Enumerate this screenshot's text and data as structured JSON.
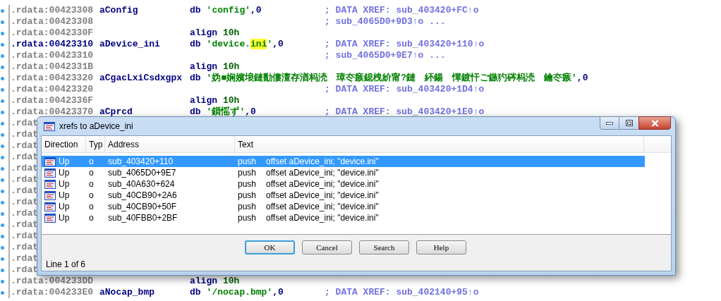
{
  "listing": {
    "rows": [
      {
        "address": ".rdata:00423308",
        "current": false,
        "label": "aConfig",
        "op": "db",
        "operand": [
          {
            "text": "'config'",
            "kind": "string"
          },
          {
            "text": ",0",
            "kind": "plain"
          }
        ],
        "comment": "; DATA XREF: sub_403420+FC↑o"
      },
      {
        "address": ".rdata:00423308",
        "current": false,
        "label": "",
        "op": "",
        "operand": [],
        "comment": "; sub_4065D0+9D3↑o ..."
      },
      {
        "address": ".rdata:0042330F",
        "current": false,
        "label": "",
        "op": "align",
        "operand": [
          {
            "text": "10h",
            "kind": "number"
          }
        ],
        "comment": ""
      },
      {
        "address": ".rdata:00423310",
        "current": true,
        "label": "aDevice_ini",
        "op": "db",
        "operand": [
          {
            "text": "'device.",
            "kind": "string"
          },
          {
            "text": "ini",
            "kind": "highlight"
          },
          {
            "text": "'",
            "kind": "string"
          },
          {
            "text": ",0",
            "kind": "plain"
          }
        ],
        "comment": "; DATA XREF: sub_403420+110↑o"
      },
      {
        "address": ".rdata:00423310",
        "current": false,
        "label": "",
        "op": "",
        "operand": [],
        "comment": "; sub_4065D0+9E7↑o ..."
      },
      {
        "address": ".rdata:0042331B",
        "current": false,
        "label": "",
        "op": "align",
        "operand": [
          {
            "text": "10h",
            "kind": "number"
          }
        ],
        "comment": ""
      },
      {
        "address": ".rdata:00423320",
        "current": false,
        "label": "aCgacLxiCsdxgpx",
        "op": "db",
        "operand": [
          {
            "text": "'妫■娴嬪埌鏈勫僂澶存湭杩涜　璋冭瘯鎴栧紒甯?鏈　紑鍚　憚鍍忓ご鏃犳硶杩涜　鑰冭瘯'",
            "kind": "string"
          },
          {
            "text": ",0",
            "kind": "plain"
          }
        ],
        "comment": ""
      },
      {
        "address": ".rdata:00423320",
        "current": false,
        "label": "",
        "op": "",
        "operand": [],
        "comment": "; DATA XREF: sub_403420+1D4↑o"
      },
      {
        "address": ".rdata:0042336F",
        "current": false,
        "label": "",
        "op": "align",
        "operand": [
          {
            "text": "10h",
            "kind": "number"
          }
        ],
        "comment": ""
      },
      {
        "address": ".rdata:00423370",
        "current": false,
        "label": "aCprcd",
        "op": "db",
        "operand": [
          {
            "text": "'鎻愮ず'",
            "kind": "string"
          },
          {
            "text": ",0",
            "kind": "plain"
          }
        ],
        "comment": "; DATA XREF: sub_403420+1E0↑o"
      },
      {
        "address": ".rdat",
        "current": false,
        "label": "",
        "op": "",
        "operand": [],
        "comment": ""
      },
      {
        "address": ".rdat",
        "current": false,
        "label": "",
        "op": "",
        "operand": [],
        "comment": ""
      },
      {
        "address": ".rdat",
        "current": false,
        "label": "",
        "op": "",
        "operand": [],
        "comment": ""
      },
      {
        "address": ".rdat",
        "current": false,
        "label": "",
        "op": "",
        "operand": [],
        "comment": ""
      },
      {
        "address": ".rdat",
        "current": false,
        "label": "",
        "op": "",
        "operand": [],
        "comment": ""
      },
      {
        "address": ".rdat",
        "current": false,
        "label": "",
        "op": "",
        "operand": [],
        "comment": ""
      },
      {
        "address": ".rdat",
        "current": false,
        "label": "",
        "op": "",
        "operand": [],
        "comment": ""
      },
      {
        "address": ".rdat",
        "current": false,
        "label": "",
        "op": "",
        "operand": [],
        "comment": ""
      },
      {
        "address": ".rdat",
        "current": false,
        "label": "",
        "op": "",
        "operand": [],
        "comment": ""
      },
      {
        "address": ".rdat",
        "current": false,
        "label": "",
        "op": "",
        "operand": [],
        "comment": ""
      },
      {
        "address": ".rdat",
        "current": false,
        "label": "",
        "op": "",
        "operand": [],
        "comment": ""
      },
      {
        "address": ".rdat",
        "current": false,
        "label": "",
        "op": "",
        "operand": [],
        "comment": ""
      },
      {
        "address": ".rdat",
        "current": false,
        "label": "",
        "op": "",
        "operand": [],
        "comment": ""
      },
      {
        "address": ".rdat",
        "current": false,
        "label": "",
        "op": "",
        "operand": [],
        "comment": ""
      },
      {
        "address": ".rdata:004233DD",
        "current": false,
        "label": "",
        "op": "align",
        "operand": [
          {
            "text": "10h",
            "kind": "number"
          }
        ],
        "comment": ""
      },
      {
        "address": ".rdata:004233E0",
        "current": false,
        "label": "aNocap_bmp",
        "op": "db",
        "operand": [
          {
            "text": "'/nocap.bmp'",
            "kind": "string"
          },
          {
            "text": ",0",
            "kind": "plain"
          }
        ],
        "comment": "; DATA XREF: sub_402140+95↑o"
      }
    ]
  },
  "dialog": {
    "title": "xrefs to aDevice_ini",
    "columns": [
      "Direction",
      "Typ",
      "Address",
      "Text"
    ],
    "rows": [
      {
        "direction": "Up",
        "type": "o",
        "address": "sub_403420+110",
        "mnemonic": "push",
        "operands": "offset aDevice_ini; \"device.ini\"",
        "selected": true
      },
      {
        "direction": "Up",
        "type": "o",
        "address": "sub_4065D0+9E7",
        "mnemonic": "push",
        "operands": "offset aDevice_ini; \"device.ini\"",
        "selected": false
      },
      {
        "direction": "Up",
        "type": "o",
        "address": "sub_40A630+624",
        "mnemonic": "push",
        "operands": "offset aDevice_ini; \"device.ini\"",
        "selected": false
      },
      {
        "direction": "Up",
        "type": "o",
        "address": "sub_40CB90+2A6",
        "mnemonic": "push",
        "operands": "offset aDevice_ini; \"device.ini\"",
        "selected": false
      },
      {
        "direction": "Up",
        "type": "o",
        "address": "sub_40CB90+50F",
        "mnemonic": "push",
        "operands": "offset aDevice_ini; \"device.ini\"",
        "selected": false
      },
      {
        "direction": "Up",
        "type": "o",
        "address": "sub_40FBB0+2BF",
        "mnemonic": "push",
        "operands": "offset aDevice_ini; \"device.ini\"",
        "selected": false
      }
    ],
    "buttons": [
      {
        "label": "OK",
        "default": true
      },
      {
        "label": "Cancel",
        "default": false
      },
      {
        "label": "Search",
        "default": false
      },
      {
        "label": "Help",
        "default": false
      }
    ],
    "status": "Line 1 of 6"
  }
}
